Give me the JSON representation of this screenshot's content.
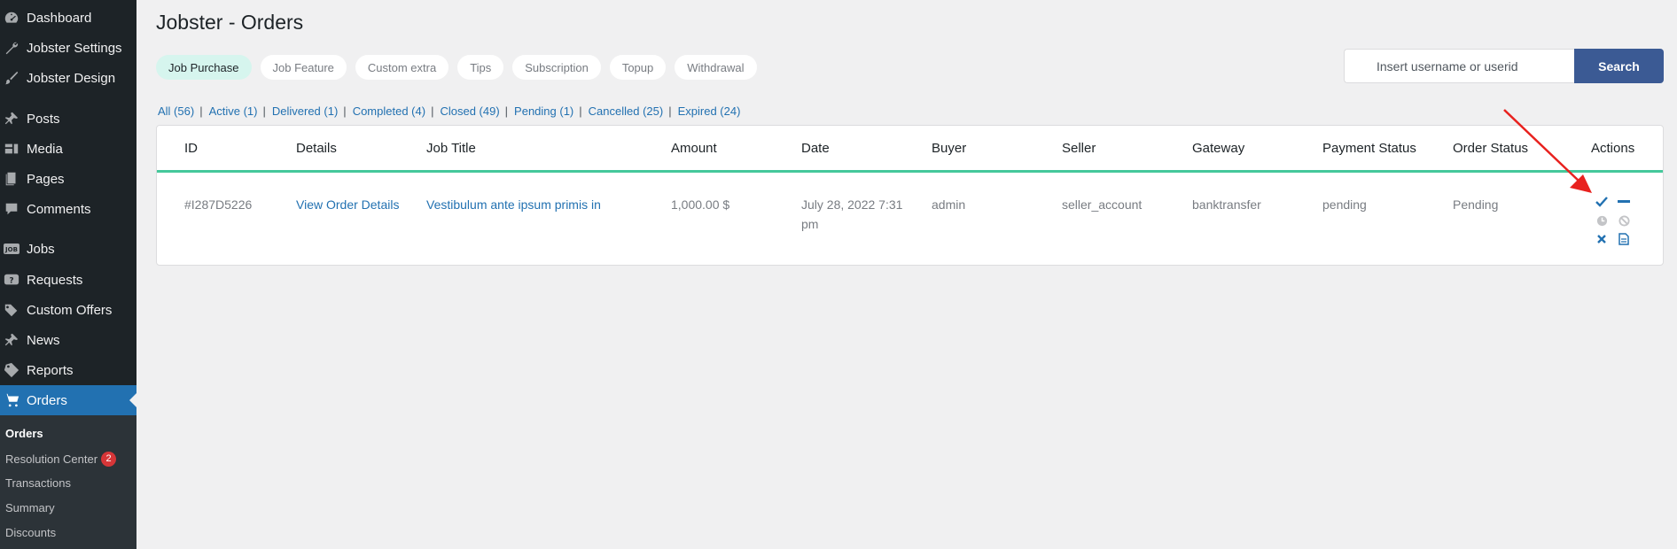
{
  "sidebar": {
    "items": [
      {
        "label": "Dashboard",
        "icon": "dashboard-icon"
      },
      {
        "label": "Jobster Settings",
        "icon": "wrench-icon"
      },
      {
        "label": "Jobster Design",
        "icon": "brush-icon"
      },
      {
        "label": "Posts",
        "icon": "pin-icon"
      },
      {
        "label": "Media",
        "icon": "media-icon"
      },
      {
        "label": "Pages",
        "icon": "pages-icon"
      },
      {
        "label": "Comments",
        "icon": "comment-icon"
      },
      {
        "label": "Jobs",
        "icon": "jobs-icon"
      },
      {
        "label": "Requests",
        "icon": "requests-icon"
      },
      {
        "label": "Custom Offers",
        "icon": "tags-icon"
      },
      {
        "label": "News",
        "icon": "pin-icon"
      },
      {
        "label": "Reports",
        "icon": "tag-icon"
      },
      {
        "label": "Orders",
        "icon": "cart-icon"
      }
    ],
    "submenu": [
      {
        "label": "Orders"
      },
      {
        "label": "Resolution Center",
        "badge": "2"
      },
      {
        "label": "Transactions"
      },
      {
        "label": "Summary"
      },
      {
        "label": "Discounts"
      }
    ]
  },
  "page": {
    "title": "Jobster - Orders"
  },
  "tabs": [
    "Job Purchase",
    "Job Feature",
    "Custom extra",
    "Tips",
    "Subscription",
    "Topup",
    "Withdrawal"
  ],
  "search": {
    "placeholder": "Insert username or userid",
    "button": "Search"
  },
  "filters": [
    "All (56)",
    "Active (1)",
    "Delivered (1)",
    "Completed (4)",
    "Closed (49)",
    "Pending (1)",
    "Cancelled (25)",
    "Expired (24)"
  ],
  "table": {
    "headers": [
      "ID",
      "Details",
      "Job Title",
      "Amount",
      "Date",
      "Buyer",
      "Seller",
      "Gateway",
      "Payment Status",
      "Order Status",
      "Actions"
    ],
    "rows": [
      {
        "id": "#I287D5226",
        "details": "View Order Details",
        "job_title": "Vestibulum ante ipsum primis in",
        "amount": "1,000.00 $",
        "date_line1": "July 28, 2022 7:31",
        "date_line2": "pm",
        "buyer": "admin",
        "seller": "seller_account",
        "gateway": "banktransfer",
        "payment_status": "pending",
        "order_status": "Pending"
      }
    ]
  },
  "colors": {
    "accent": "#2271b1",
    "sidebar": "#1d2327",
    "highlight_border": "#45c89b",
    "arrow": "#e8211e"
  }
}
